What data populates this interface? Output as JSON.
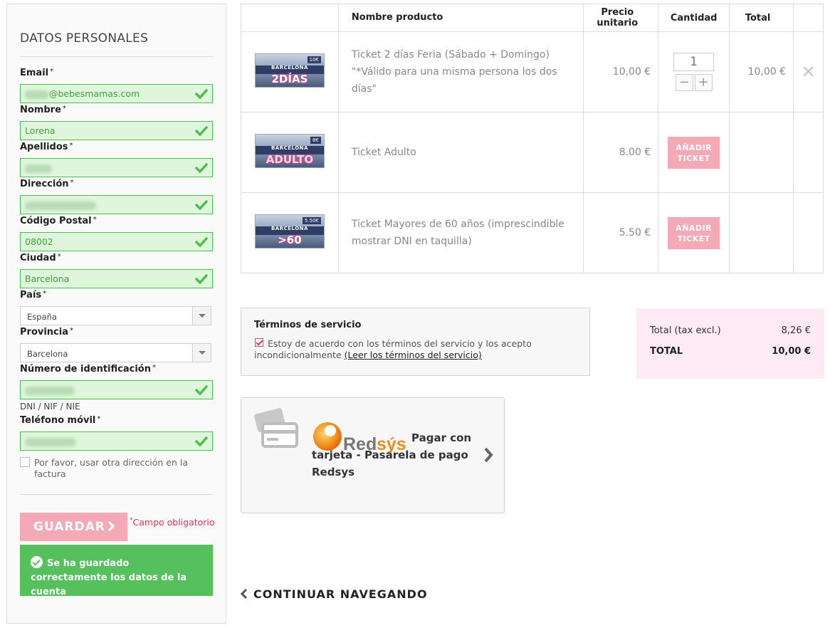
{
  "personal": {
    "title": "DATOS PERSONALES",
    "required_star": "*",
    "email": {
      "label": "Email",
      "value": "@bebesmamas.com"
    },
    "nombre": {
      "label": "Nombre",
      "value": "Lorena"
    },
    "apellidos": {
      "label": "Apellidos",
      "value": ""
    },
    "direccion": {
      "label": "Dirección",
      "value": ""
    },
    "codigo_postal": {
      "label": "Código Postal",
      "value": "08002"
    },
    "ciudad": {
      "label": "Ciudad",
      "value": "Barcelona"
    },
    "pais": {
      "label": "País",
      "value": "España"
    },
    "provincia": {
      "label": "Provincia",
      "value": "Barcelona"
    },
    "identificacion": {
      "label": "Número de identificación",
      "value": "",
      "hint": "DNI / NIF / NIE"
    },
    "telefono": {
      "label": "Teléfono móvil",
      "value": ""
    },
    "other_address_label": "Por favor, usar otra dirección en la factura",
    "save_label": "GUARDAR",
    "required_note": "Campo obligatorio",
    "success_message": "Se ha guardado correctamente los datos de la cuenta"
  },
  "cart": {
    "headers": [
      "",
      "Nombre producto",
      "Precio unitario",
      "Cantidad",
      "Total",
      ""
    ],
    "items": [
      {
        "name": "Ticket 2 días Feria (Sábado + Domingo) \"*Válido para una misma persona los dos días\"",
        "price": "10,00 €",
        "qty": "1",
        "total": "10,00 €",
        "image_city": "BARCELONA",
        "image_label": "2DÍAS",
        "image_price": "10€"
      },
      {
        "name": "Ticket Adulto",
        "price": "8.00 €",
        "add_label": "AÑADIR TICKET",
        "image_city": "BARCELONA",
        "image_label": "ADULTO",
        "image_price": "8€"
      },
      {
        "name": "Ticket Mayores de 60 años (imprescindible mostrar DNI en taquilla)",
        "price": "5.50 €",
        "add_label": "AÑADIR TICKET",
        "image_city": "BARCELONA",
        "image_label": ">60",
        "image_price": "5.50€"
      }
    ],
    "qty_minus": "−",
    "qty_plus": "+",
    "remove_symbol": "✕"
  },
  "terms": {
    "title": "Términos de servicio",
    "text": "Estoy de acuerdo con los términos del servicio y los acepto incondicionalmente",
    "link": "(Leer los términos del servicio)",
    "checked": true
  },
  "totals": {
    "tax_excl_label": "Total (tax excl.)",
    "tax_excl_value": "8,26 €",
    "total_label": "TOTAL",
    "total_value": "10,00 €"
  },
  "payment": {
    "logo_text_1": "Red",
    "logo_text_2": "sýs",
    "label": "Pagar con tarjeta - Pasarela de pago Redsys"
  },
  "continue_label": "CONTINUAR NAVEGANDO",
  "colors": {
    "valid_green": "#4bbf4b",
    "valid_bg": "#dff5dc",
    "pink_button": "#f4a9b7",
    "success_green": "#55c05c",
    "redsys_orange": "#f08b1e"
  }
}
